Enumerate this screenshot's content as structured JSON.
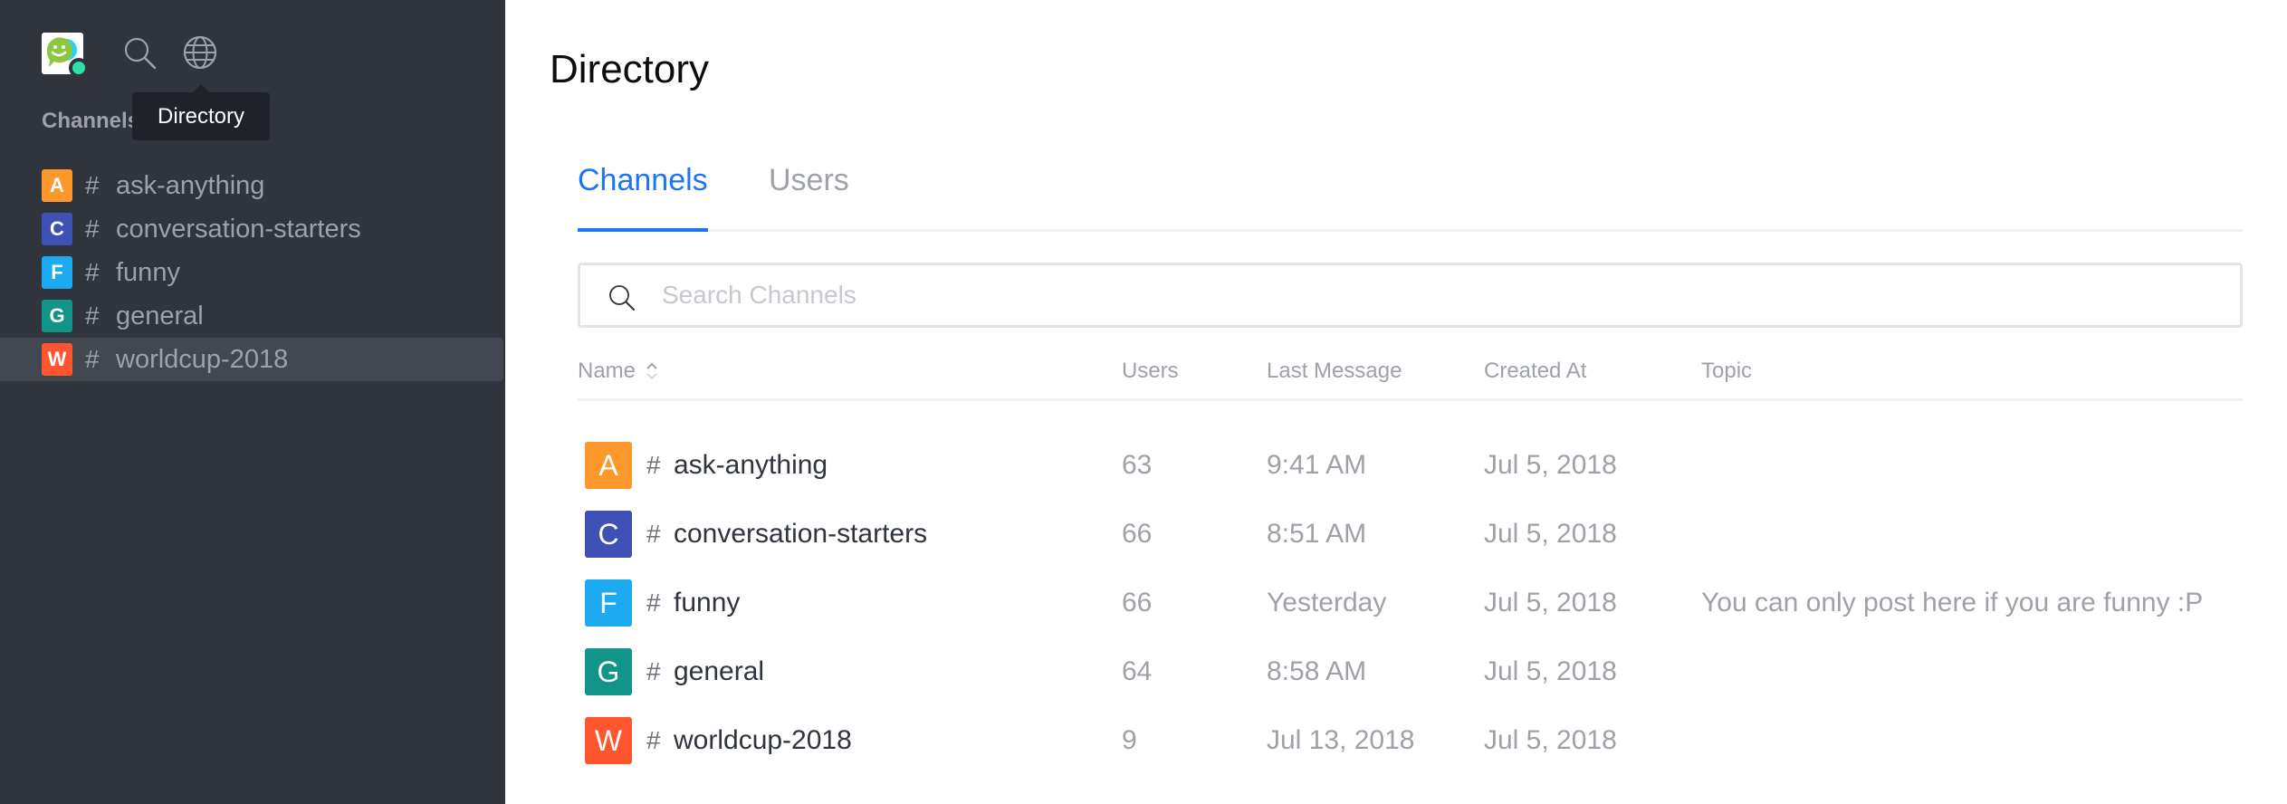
{
  "sidebar": {
    "section_title": "Channels",
    "tooltip": "Directory",
    "icons": {
      "logo": "app-logo",
      "search": "search-icon",
      "directory": "globe-icon"
    },
    "status_color": "#2de0a5",
    "channels": [
      {
        "letter": "A",
        "name": "ask-anything",
        "color": "#fd982c",
        "active": false
      },
      {
        "letter": "C",
        "name": "conversation-starters",
        "color": "#3f51b5",
        "active": false
      },
      {
        "letter": "F",
        "name": "funny",
        "color": "#1eaaf1",
        "active": false
      },
      {
        "letter": "G",
        "name": "general",
        "color": "#129588",
        "active": false
      },
      {
        "letter": "W",
        "name": "worldcup-2018",
        "color": "#ff5630",
        "active": true
      }
    ]
  },
  "main": {
    "title": "Directory",
    "tabs": [
      {
        "label": "Channels",
        "active": true
      },
      {
        "label": "Users",
        "active": false
      }
    ],
    "search": {
      "placeholder": "Search Channels",
      "value": ""
    },
    "accent_color": "#1d74f5",
    "table": {
      "headers": {
        "name": "Name",
        "users": "Users",
        "last_message": "Last Message",
        "created_at": "Created At",
        "topic": "Topic"
      },
      "rows": [
        {
          "letter": "A",
          "color": "#fd982c",
          "name": "ask-anything",
          "users": "63",
          "last_message": "9:41 AM",
          "created_at": "Jul 5, 2018",
          "topic": ""
        },
        {
          "letter": "C",
          "color": "#3f51b5",
          "name": "conversation-starters",
          "users": "66",
          "last_message": "8:51 AM",
          "created_at": "Jul 5, 2018",
          "topic": ""
        },
        {
          "letter": "F",
          "color": "#1eaaf1",
          "name": "funny",
          "users": "66",
          "last_message": "Yesterday",
          "created_at": "Jul 5, 2018",
          "topic": "You can only post here if you are funny :P"
        },
        {
          "letter": "G",
          "color": "#129588",
          "name": "general",
          "users": "64",
          "last_message": "8:58 AM",
          "created_at": "Jul 5, 2018",
          "topic": ""
        },
        {
          "letter": "W",
          "color": "#ff5630",
          "name": "worldcup-2018",
          "users": "9",
          "last_message": "Jul 13, 2018",
          "created_at": "Jul 5, 2018",
          "topic": ""
        }
      ]
    }
  }
}
